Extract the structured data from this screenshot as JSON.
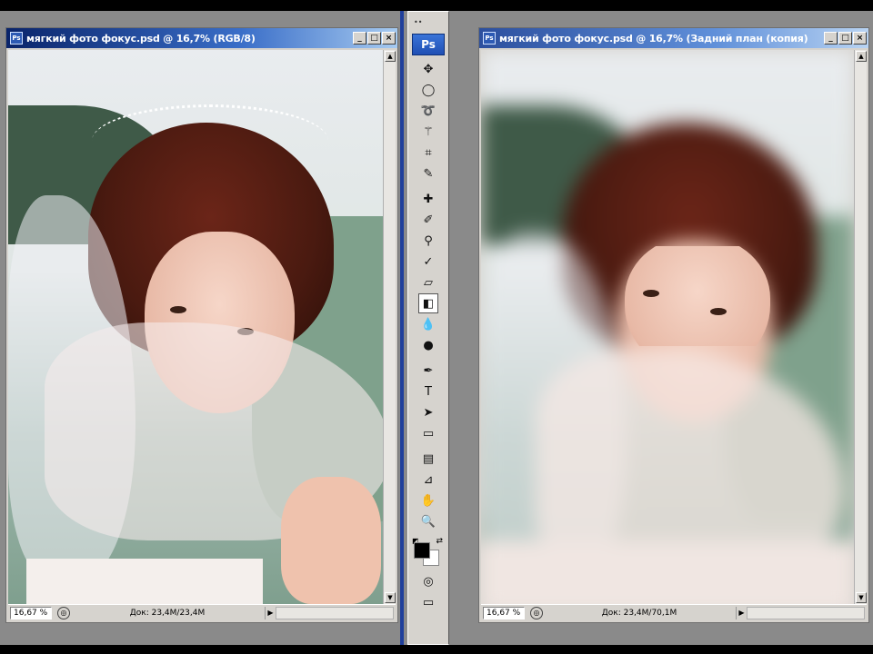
{
  "left_window": {
    "title": "мягкий фото фокус.psd @ 16,7% (RGB/8)",
    "zoom": "16,67 %",
    "doc_size": "Док: 23,4M/23,4M",
    "app_badge": "Ps"
  },
  "right_window": {
    "title": "мягкий фото фокус.psd @ 16,7% (Задний план (копия)",
    "zoom": "16,67 %",
    "doc_size": "Док: 23,4M/70,1M",
    "app_badge": "Ps"
  },
  "window_buttons": {
    "minimize": "_",
    "maximize": "□",
    "close": "×"
  },
  "toolbox": {
    "logo": "Ps",
    "grip": "••",
    "tools": [
      {
        "name": "move-tool",
        "glyph": "✥"
      },
      {
        "name": "elliptical-marquee-tool",
        "glyph": "◯"
      },
      {
        "name": "lasso-tool",
        "glyph": "➰"
      },
      {
        "name": "magic-wand-tool",
        "glyph": "⚚"
      },
      {
        "name": "crop-tool",
        "glyph": "⌗"
      },
      {
        "name": "slice-tool",
        "glyph": "✎"
      },
      {
        "name": "healing-brush-tool",
        "glyph": "✚"
      },
      {
        "name": "brush-tool",
        "glyph": "✐"
      },
      {
        "name": "clone-stamp-tool",
        "glyph": "⚲"
      },
      {
        "name": "history-brush-tool",
        "glyph": "✓"
      },
      {
        "name": "eraser-tool",
        "glyph": "▱"
      },
      {
        "name": "gradient-tool",
        "glyph": "◧"
      },
      {
        "name": "blur-tool",
        "glyph": "💧"
      },
      {
        "name": "dodge-tool",
        "glyph": "●"
      },
      {
        "name": "pen-tool",
        "glyph": "✒"
      },
      {
        "name": "type-tool",
        "glyph": "T"
      },
      {
        "name": "path-selection-tool",
        "glyph": "➤"
      },
      {
        "name": "rectangle-tool",
        "glyph": "▭"
      },
      {
        "name": "notes-tool",
        "glyph": "▤"
      },
      {
        "name": "eyedropper-tool",
        "glyph": "⊿"
      },
      {
        "name": "hand-tool",
        "glyph": "✋"
      },
      {
        "name": "zoom-tool",
        "glyph": "🔍"
      }
    ],
    "default_colors_glyph": "◩",
    "swap_colors_glyph": "⇄",
    "foreground_color": "#000000",
    "background_color": "#ffffff",
    "quick_mask_glyph": "◎",
    "screen_mode_glyph": "▭"
  },
  "colors": {
    "workspace": "#8a8a8a",
    "separator": "#1f3f9c",
    "titlebar_active": "#0a246a"
  }
}
